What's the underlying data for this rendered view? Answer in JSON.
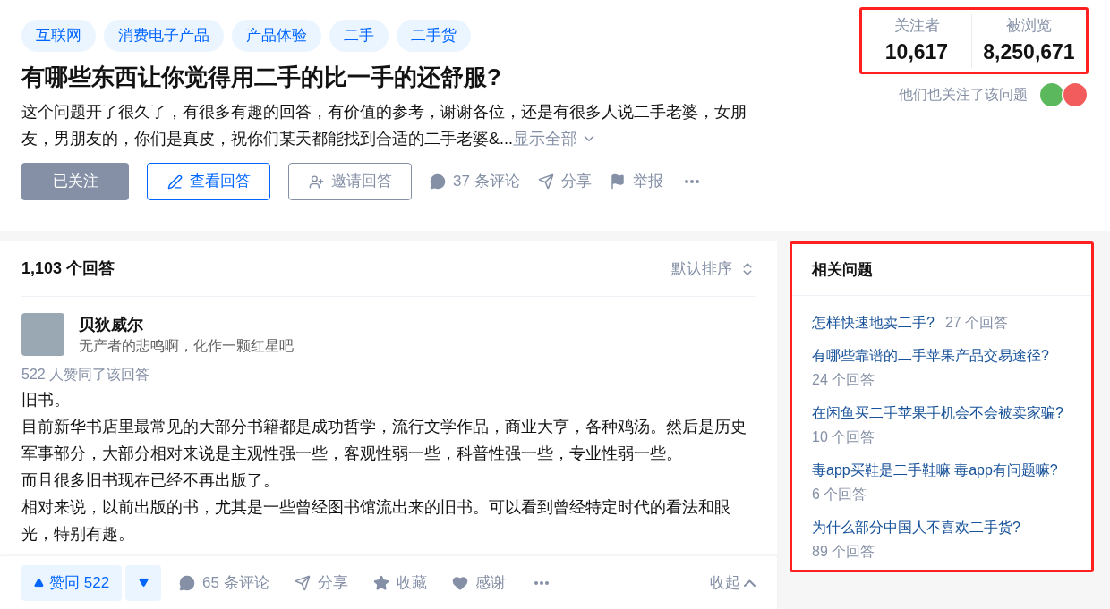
{
  "topics": [
    "互联网",
    "消费电子产品",
    "产品体验",
    "二手",
    "二手货"
  ],
  "question": {
    "title": "有哪些东西让你觉得用二手的比一手的还舒服?",
    "excerpt": "这个问题开了很久了，有很多有趣的回答，有价值的参考，谢谢各位，还是有很多人说二手老婆，女朋友，男朋友的，你们是真皮，祝你们某天都能找到合适的二手老婆&...",
    "show_all": "显示全部"
  },
  "actions": {
    "follow": {
      "label": "已关注",
      "followed": true
    },
    "view_answers": "查看回答",
    "invite": "邀请回答",
    "comments": "37 条评论",
    "share": "分享",
    "report": "举报"
  },
  "stats": {
    "highlighted": true,
    "items": [
      {
        "label": "关注者",
        "value": "10,617"
      },
      {
        "label": "被浏览",
        "value": "8,250,671"
      }
    ]
  },
  "also_followed": "他们也关注了该问题",
  "answers": {
    "count": "1,103 个回答",
    "sort": "默认排序"
  },
  "answer": {
    "author": "贝狄威尔",
    "bio": "无产者的悲鸣啊，化作一颗红星吧",
    "upvoted_by": "522 人赞同了该回答",
    "paragraphs": [
      "旧书。",
      "目前新华书店里最常见的大部分书籍都是成功哲学，流行文学作品，商业大亨，各种鸡汤。然后是历史军事部分，大部分相对来说是主观性强一些，客观性弱一些，科普性强一些，专业性弱一些。",
      "而且很多旧书现在已经不再出版了。",
      "相对来说，以前出版的书，尤其是一些曾经图书馆流出来的旧书。可以看到曾经特定时代的看法和眼光，特别有趣。"
    ],
    "vote": "赞同 522",
    "comments": "65 条评论",
    "share": "分享",
    "collect": "收藏",
    "thanks": "感谢",
    "collapse": "收起"
  },
  "related": {
    "highlighted": true,
    "title": "相关问题",
    "items": [
      {
        "question": "怎样快速地卖二手?",
        "answers": "27 个回答"
      },
      {
        "question": "有哪些靠谱的二手苹果产品交易途径?",
        "answers": "24 个回答"
      },
      {
        "question": "在闲鱼买二手苹果手机会不会被卖家骗?",
        "answers": "10 个回答"
      },
      {
        "question": "毒app买鞋是二手鞋嘛 毒app有问题嘛?",
        "answers": "6 个回答"
      },
      {
        "question": "为什么部分中国人不喜欢二手货?",
        "answers": "89 个回答"
      }
    ]
  }
}
